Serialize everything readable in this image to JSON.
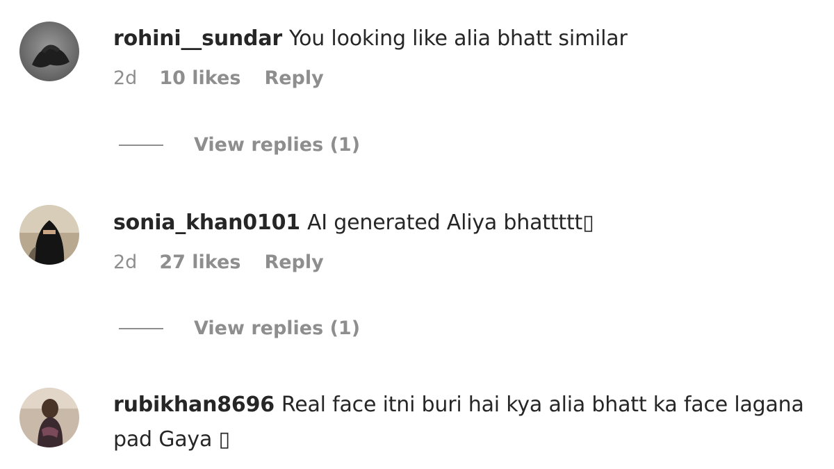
{
  "comments": [
    {
      "username": "rohini__sundar",
      "text": "You looking like alia bhatt similar",
      "timestamp": "2d",
      "likes": "10 likes",
      "reply_label": "Reply",
      "view_replies": "View replies (1)",
      "avatar_icon": "profile-photo"
    },
    {
      "username": "sonia_khan0101",
      "text": "AI generated Aliya bhattttt▯",
      "timestamp": "2d",
      "likes": "27 likes",
      "reply_label": "Reply",
      "view_replies": "View replies (1)",
      "avatar_icon": "profile-photo"
    },
    {
      "username": "rubikhan8696",
      "text": "Real face itni buri hai kya alia bhatt ka face lagana pad Gaya ▯",
      "avatar_icon": "profile-photo"
    }
  ],
  "colors": {
    "text_primary": "#262626",
    "text_secondary": "#8e8e8e"
  }
}
